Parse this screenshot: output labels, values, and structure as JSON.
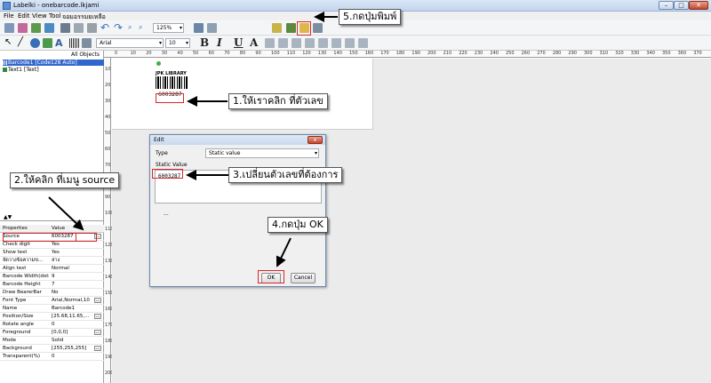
{
  "window": {
    "title": "Labelki - onebarcode.lkjami",
    "minimize": "–",
    "maximize": "□",
    "close": "✕"
  },
  "menu": [
    "File",
    "Edit",
    "View",
    "Tool",
    "จอมอรรมยเหลือ"
  ],
  "toolbar": {
    "zoom": "125%",
    "font_name": "Arial",
    "font_size": "10",
    "bold": "B",
    "italic": "I",
    "underline": "U",
    "font_color": "A"
  },
  "objects_panel": {
    "header": "All Objects",
    "items": [
      {
        "name": "Barcode1 [Code128 Auto]",
        "selected": true
      },
      {
        "name": "Text1 [Text]",
        "selected": false
      }
    ]
  },
  "properties": {
    "col_property": "Properties",
    "col_value": "Value",
    "rows": [
      {
        "key": "Source",
        "value": "6003287",
        "more": "..."
      },
      {
        "key": "Check digit",
        "value": "Yes",
        "more": ""
      },
      {
        "key": "Show text",
        "value": "Yes",
        "more": ""
      },
      {
        "key": "จัดวางข้อความข...",
        "value": "ล่าง",
        "more": ""
      },
      {
        "key": "Align text",
        "value": "Normal",
        "more": ""
      },
      {
        "key": "Barcode Width(dots)",
        "value": "9",
        "more": ""
      },
      {
        "key": "Barcode Height",
        "value": "7",
        "more": ""
      },
      {
        "key": "Draw BearerBar",
        "value": "No",
        "more": ""
      },
      {
        "key": "Font Type",
        "value": "Arial,Normal,10",
        "more": "..."
      },
      {
        "key": "Name",
        "value": "Barcode1",
        "more": ""
      },
      {
        "key": "Position/Size",
        "value": "[25.68,11.65,...",
        "more": "..."
      },
      {
        "key": "Rotate angle",
        "value": "0",
        "more": ""
      },
      {
        "key": "Foreground",
        "value": "[0,0,0]",
        "more": "..."
      },
      {
        "key": "Mode",
        "value": "Solid",
        "more": ""
      },
      {
        "key": "Background",
        "value": "[255,255,255]",
        "more": "..."
      },
      {
        "key": "Transparent(%)",
        "value": "0",
        "more": ""
      }
    ]
  },
  "ruler": {
    "h_ticks": [
      "0",
      "10",
      "20",
      "30",
      "40",
      "50",
      "60",
      "70",
      "80",
      "90",
      "100",
      "110",
      "120",
      "130",
      "140",
      "150",
      "160",
      "170",
      "180",
      "190",
      "200",
      "210",
      "220",
      "230",
      "240",
      "250",
      "260",
      "270",
      "280",
      "290",
      "300",
      "310",
      "320",
      "330",
      "340",
      "350",
      "360",
      "370"
    ],
    "v_ticks": [
      "10",
      "20",
      "30",
      "40",
      "50",
      "60",
      "70",
      "80",
      "90",
      "100",
      "110",
      "120",
      "130",
      "140",
      "150",
      "160",
      "170",
      "180",
      "190",
      "200"
    ]
  },
  "label": {
    "header_text": "JPK LIBRARY",
    "barcode_number": "6003287"
  },
  "dialog": {
    "title": "Edit",
    "close": "x",
    "type_label": "Type",
    "type_value": "Static value",
    "static_label": "Static Value",
    "static_value": "6003287",
    "ellipsis": "...",
    "ok": "OK",
    "cancel": "Cancel"
  },
  "annotations": {
    "step1": "1.ให้เราคลิก ที่ตัวเลข",
    "step2": "2.ให้คลิก ที่เมนู source",
    "step3": "3.เปลี่ยนตัวเลขที่ต้องการ",
    "step4": "4.กดปุ่ม OK",
    "step5": "5.กดปุ่มพิมพ์"
  },
  "colors": {
    "highlight_red": "#d9262b",
    "selection_blue": "#3366cc"
  }
}
